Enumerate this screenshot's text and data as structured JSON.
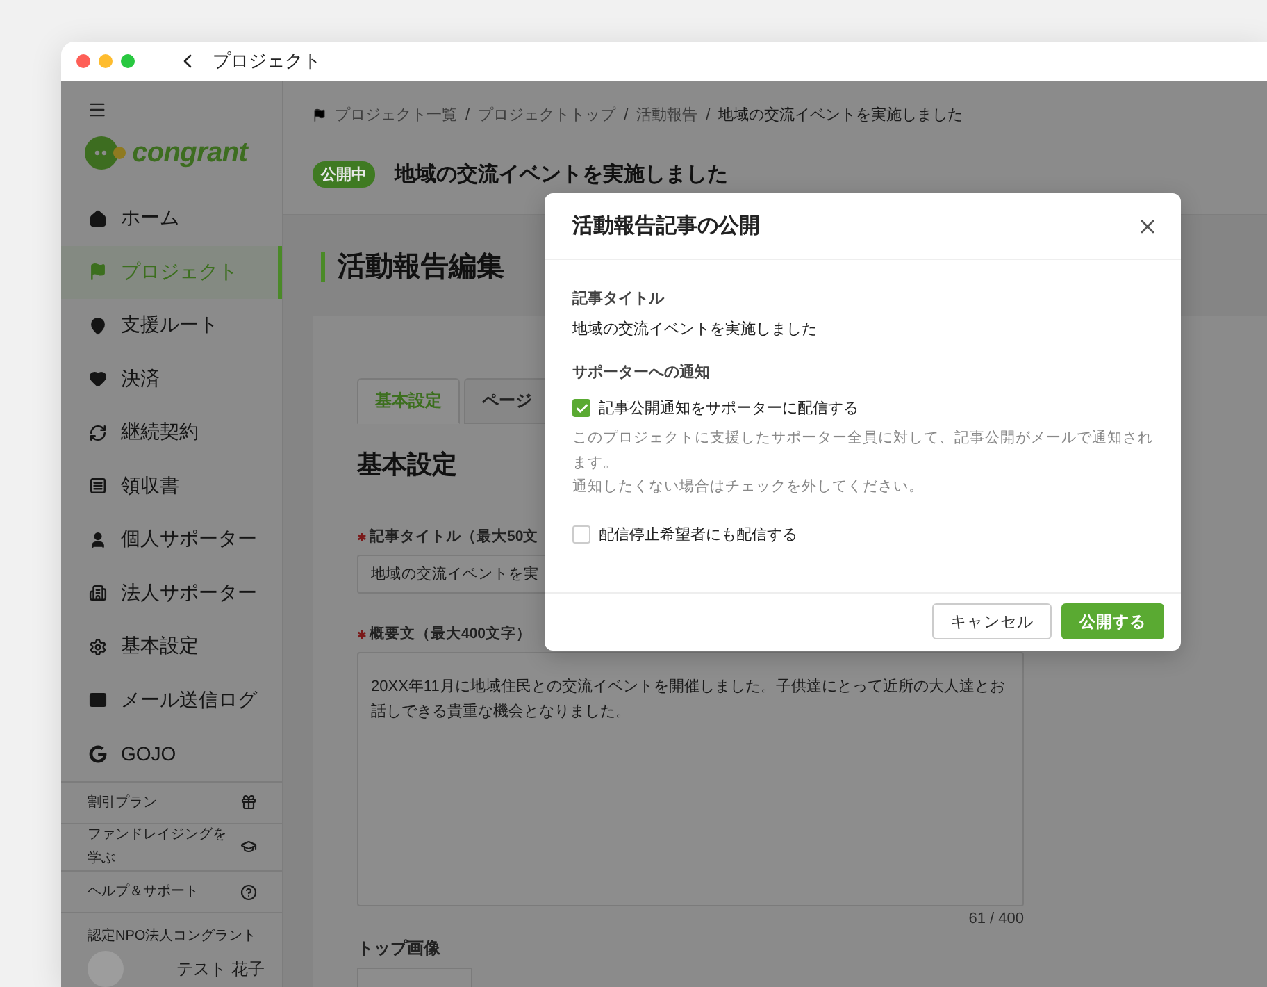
{
  "window": {
    "title": "プロジェクト"
  },
  "sidebar": {
    "logo_text": "congrant",
    "items": [
      {
        "label": "ホーム",
        "selected": false
      },
      {
        "label": "プロジェクト",
        "selected": true
      },
      {
        "label": "支援ルート",
        "selected": false
      },
      {
        "label": "決済",
        "selected": false
      },
      {
        "label": "継続契約",
        "selected": false
      },
      {
        "label": "領収書",
        "selected": false
      },
      {
        "label": "個人サポーター",
        "selected": false
      },
      {
        "label": "法人サポーター",
        "selected": false
      },
      {
        "label": "基本設定",
        "selected": false
      },
      {
        "label": "メール送信ログ",
        "selected": false
      },
      {
        "label": "GOJO",
        "selected": false
      }
    ],
    "footer_links": [
      {
        "label": "割引プラン"
      },
      {
        "label": "ファンドレイジングを学ぶ"
      },
      {
        "label": "ヘルプ＆サポート"
      }
    ],
    "organization": "認定NPO法人コングラント",
    "user_name": "テスト 花子"
  },
  "breadcrumb": {
    "separator": "/",
    "items": [
      "プロジェクト一覧",
      "プロジェクトトップ",
      "活動報告",
      "地域の交流イベントを実施しました"
    ]
  },
  "project": {
    "status": "公開中",
    "title": "地域の交流イベントを実施しました"
  },
  "page_title": "活動報告編集",
  "tabs": [
    {
      "label": "基本設定",
      "selected": true
    },
    {
      "label": "ページ",
      "selected": false
    }
  ],
  "section_title": "基本設定",
  "fields": [
    {
      "kind": "input",
      "label": "記事タイトル（最大50文",
      "required": true,
      "value": "地域の交流イベントを実"
    },
    {
      "kind": "textarea",
      "label": "概要文（最大400文字）",
      "required": true,
      "value": "20XX年11月に地域住民との交流イベントを開催しました。子供達にとって近所の大人達とお話しできる貴重な機会となりました。",
      "counter": "61 / 400"
    }
  ],
  "image_label": "トップ画像",
  "dialog": {
    "title": "活動報告記事の公開",
    "article_label": "記事タイトル",
    "article_title": "地域の交流イベントを実施しました",
    "notify_label": "サポーターへの通知",
    "options": [
      {
        "label": "記事公開通知をサポーターに配信する",
        "checked": true,
        "notes": [
          "このプロジェクトに支援したサポーター全員に対して、記事公開がメールで通知されます。",
          "通知したくない場合はチェックを外してください。"
        ]
      },
      {
        "label": "配信停止希望者にも配信する",
        "checked": false
      }
    ],
    "buttons": [
      {
        "label": "キャンセル",
        "kind": "secondary"
      },
      {
        "label": "公開する",
        "kind": "primary"
      }
    ]
  }
}
